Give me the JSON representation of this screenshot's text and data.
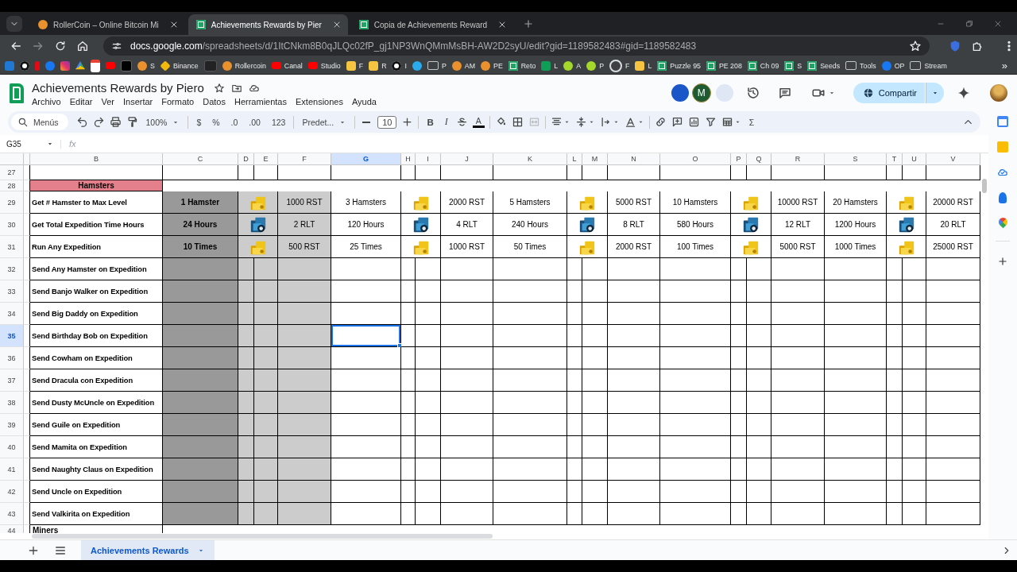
{
  "browser": {
    "tabs": [
      {
        "title": "RollerCoin – Online Bitcoin Mi",
        "kind": "hamster",
        "selected": false
      },
      {
        "title": "Achievements Rewards by Pier",
        "kind": "sheets",
        "selected": true
      },
      {
        "title": "Copia de Achievements Reward",
        "kind": "sheets",
        "selected": false
      }
    ],
    "url_host": "docs.google.com",
    "url_path": "/spreadsheets/d/1ItCNkm8B0qJLQc02fP_gj1NP3WnQMmMsBH-AW2D2syU/edit?gid=1189582483#gid=1189582483",
    "bookmarks": [
      {
        "kind": "outlook"
      },
      {
        "kind": "threads"
      },
      {
        "kind": "netflix"
      },
      {
        "kind": "facebook"
      },
      {
        "kind": "instagram"
      },
      {
        "kind": "drive"
      },
      {
        "kind": "gmail"
      },
      {
        "kind": "youtube"
      },
      {
        "kind": "x"
      },
      {
        "kind": "hamster",
        "label": "S"
      },
      {
        "kind": "binance",
        "label": "Binance"
      },
      {
        "kind": "dark"
      },
      {
        "kind": "hamster",
        "label": "Rollercoin"
      },
      {
        "kind": "youtube",
        "label": "Canal"
      },
      {
        "kind": "youtube",
        "label": "Studio"
      },
      {
        "kind": "face",
        "label": "F"
      },
      {
        "kind": "face",
        "label": "R"
      },
      {
        "kind": "threads",
        "label": "I"
      },
      {
        "kind": "telegram"
      },
      {
        "kind": "folder",
        "label": "P"
      },
      {
        "kind": "hamster",
        "label": "AM"
      },
      {
        "kind": "hamster",
        "label": "PE"
      },
      {
        "kind": "sheets",
        "label": "Reto"
      },
      {
        "kind": "green",
        "label": "L"
      },
      {
        "kind": "lime",
        "label": "A"
      },
      {
        "kind": "lime",
        "label": "P"
      },
      {
        "kind": "ring",
        "label": "F"
      },
      {
        "kind": "face",
        "label": "L"
      },
      {
        "kind": "sheets",
        "label": "Puzzle 95"
      },
      {
        "kind": "sheets",
        "label": "PE 208"
      },
      {
        "kind": "sheets",
        "label": "Ch 09"
      },
      {
        "kind": "sheets",
        "label": "S"
      },
      {
        "kind": "sheets",
        "label": "Seeds"
      },
      {
        "kind": "folder",
        "label": "Tools"
      },
      {
        "kind": "facebook",
        "label": "OP"
      },
      {
        "kind": "folder",
        "label": "Stream"
      }
    ],
    "bookmarks_overflow": "»"
  },
  "sheet": {
    "title": "Achievements Rewards by Piero",
    "menu": [
      "Archivo",
      "Editar",
      "Ver",
      "Insertar",
      "Formato",
      "Datos",
      "Herramientas",
      "Extensiones",
      "Ayuda"
    ],
    "avatar_letter": "M",
    "share_label": "Compartir",
    "toolbar": [
      {
        "kind": "search",
        "text": "Menús"
      },
      {
        "kind": "undo"
      },
      {
        "kind": "redo"
      },
      {
        "kind": "print"
      },
      {
        "kind": "paint-format"
      },
      {
        "kind": "dropdown",
        "text": "100%"
      },
      {
        "kind": "sep"
      },
      {
        "kind": "text",
        "text": "$"
      },
      {
        "kind": "text",
        "text": "%"
      },
      {
        "kind": "text",
        "text": ".0"
      },
      {
        "kind": "text",
        "text": ".00"
      },
      {
        "kind": "text",
        "text": "123"
      },
      {
        "kind": "sep"
      },
      {
        "kind": "dropdown",
        "text": "Predet..."
      },
      {
        "kind": "sep"
      },
      {
        "kind": "minus"
      },
      {
        "kind": "field",
        "text": "10"
      },
      {
        "kind": "plus"
      },
      {
        "kind": "sep"
      },
      {
        "kind": "bold",
        "text": "B"
      },
      {
        "kind": "italic",
        "text": "I"
      },
      {
        "kind": "strikethrough"
      },
      {
        "kind": "underlined",
        "text": "A"
      },
      {
        "kind": "sep"
      },
      {
        "kind": "fill-color"
      },
      {
        "kind": "borders"
      },
      {
        "kind": "merge"
      },
      {
        "kind": "sep"
      },
      {
        "kind": "align"
      },
      {
        "kind": "vertical-align"
      },
      {
        "kind": "wrap"
      },
      {
        "kind": "rotate"
      },
      {
        "kind": "sep"
      },
      {
        "kind": "link"
      },
      {
        "kind": "add-comment"
      },
      {
        "kind": "chart"
      },
      {
        "kind": "filter"
      },
      {
        "kind": "table"
      },
      {
        "kind": "text",
        "text": "Σ"
      }
    ],
    "name_box": "G35",
    "formula_label": "fx",
    "columns": [
      {
        "letter": "B",
        "selected": false
      },
      {
        "letter": "C",
        "selected": false
      },
      {
        "letter": "D",
        "selected": false
      },
      {
        "letter": "E",
        "selected": false
      },
      {
        "letter": "F",
        "selected": false
      },
      {
        "letter": "G",
        "selected": true
      },
      {
        "letter": "H",
        "selected": false
      },
      {
        "letter": "I",
        "selected": false
      },
      {
        "letter": "J",
        "selected": false
      },
      {
        "letter": "K",
        "selected": false
      },
      {
        "letter": "L",
        "selected": false
      },
      {
        "letter": "M",
        "selected": false
      },
      {
        "letter": "N",
        "selected": false
      },
      {
        "letter": "O",
        "selected": false
      },
      {
        "letter": "P",
        "selected": false
      },
      {
        "letter": "Q",
        "selected": false
      },
      {
        "letter": "R",
        "selected": false
      },
      {
        "letter": "S",
        "selected": false
      },
      {
        "letter": "T",
        "selected": false
      },
      {
        "letter": "U",
        "selected": false
      },
      {
        "letter": "V",
        "selected": false
      }
    ],
    "rows": [
      {
        "number": "27",
        "kind": "blank",
        "selected": false
      },
      {
        "number": "28",
        "kind": "section",
        "label": "Hamsters",
        "highlight": true,
        "selected": false
      },
      {
        "number": "29",
        "kind": "reward",
        "label": "Get # Hamster to Max Level",
        "selected": false,
        "tiers": [
          {
            "goal": "1 Hamster",
            "kind": "coins",
            "reward": "1000 RST"
          },
          {
            "goal": "3 Hamsters",
            "kind": "coins",
            "reward": "2000 RST"
          },
          {
            "goal": "5 Hamsters",
            "kind": "coins",
            "reward": "5000 RST"
          },
          {
            "goal": "10 Hamsters",
            "kind": "coins",
            "reward": "10000 RST"
          },
          {
            "goal": "20 Hamsters",
            "kind": "coins",
            "reward": "20000 RST"
          }
        ]
      },
      {
        "number": "30",
        "kind": "reward",
        "label": "Get Total Expedition Time Hours",
        "selected": false,
        "tiers": [
          {
            "goal": "24 Hours",
            "kind": "crate",
            "reward": "2 RLT"
          },
          {
            "goal": "120 Hours",
            "kind": "crate",
            "reward": "4 RLT"
          },
          {
            "goal": "240 Hours",
            "kind": "crate",
            "reward": "8 RLT"
          },
          {
            "goal": "580 Hours",
            "kind": "crate",
            "reward": "12 RLT"
          },
          {
            "goal": "1200 Hours",
            "kind": "crate",
            "reward": "20 RLT"
          }
        ]
      },
      {
        "number": "31",
        "kind": "reward",
        "label": "Run Any Expedition",
        "selected": false,
        "tiers": [
          {
            "goal": "10 Times",
            "kind": "coins",
            "reward": "500 RST"
          },
          {
            "goal": "25 Times",
            "kind": "coins",
            "reward": "1000 RST"
          },
          {
            "goal": "50 Times",
            "kind": "coins",
            "reward": "2000 RST"
          },
          {
            "goal": "100 Times",
            "kind": "coins",
            "reward": "5000 RST"
          },
          {
            "goal": "1000 Times",
            "kind": "coins",
            "reward": "25000 RST"
          }
        ]
      },
      {
        "number": "32",
        "kind": "task",
        "label": "Send Any Hamster on Expedition",
        "selected": false
      },
      {
        "number": "33",
        "kind": "task",
        "label": "Send Banjo Walker on Expedition",
        "selected": false
      },
      {
        "number": "34",
        "kind": "task",
        "label": "Send Big Daddy on Expedition",
        "selected": false
      },
      {
        "number": "35",
        "kind": "task",
        "label": "Send Birthday Bob on Expedition",
        "selected": true
      },
      {
        "number": "36",
        "kind": "task",
        "label": "Send Cowham on Expedition",
        "selected": false
      },
      {
        "number": "37",
        "kind": "task",
        "label": "Send Dracula con Expedition",
        "selected": false
      },
      {
        "number": "38",
        "kind": "task",
        "label": "Send Dusty McUncle on Expedition",
        "selected": false
      },
      {
        "number": "39",
        "kind": "task",
        "label": "Send Guile on Expedition",
        "selected": false
      },
      {
        "number": "40",
        "kind": "task",
        "label": "Send Mamita on Expedition",
        "selected": false
      },
      {
        "number": "41",
        "kind": "task",
        "label": "Send Naughty Claus on Expedition",
        "selected": false
      },
      {
        "number": "42",
        "kind": "task",
        "label": "Send Uncle on Expedition",
        "selected": false
      },
      {
        "number": "43",
        "kind": "task",
        "label": "Send Valkirita on Expedition",
        "selected": false
      },
      {
        "number": "44",
        "kind": "section",
        "label": "Miners",
        "highlight": false,
        "selected": false
      }
    ],
    "sheet_tabs": [
      {
        "label": "Achievements Rewards",
        "selected": true
      }
    ]
  }
}
